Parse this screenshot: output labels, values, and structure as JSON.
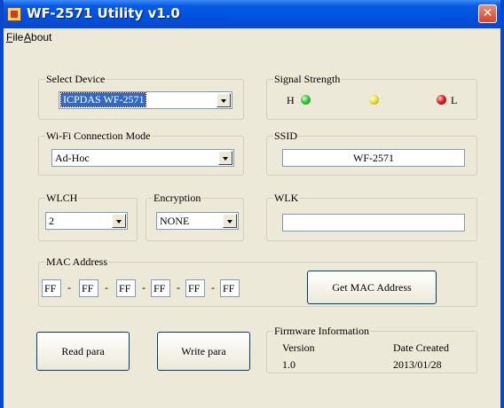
{
  "window": {
    "title": "WF-2571 Utility v1.0",
    "close_glyph": "✕"
  },
  "menu": [
    {
      "hotkey": "F",
      "rest": "ile"
    },
    {
      "hotkey": "A",
      "rest": "bout"
    }
  ],
  "select_device": {
    "label": "Select Device",
    "value": "ICPDAS WF-2571"
  },
  "signal_strength": {
    "label": "Signal Strength",
    "high_label": "H",
    "low_label": "L",
    "colors": {
      "high": "#3cc83c",
      "mid": "#f0e040",
      "low": "#e02020"
    }
  },
  "wifi_mode": {
    "label": "Wi-Fi Connection Mode",
    "value": "Ad-Hoc"
  },
  "ssid": {
    "label": "SSID",
    "value": "WF-2571"
  },
  "wlch": {
    "label": "WLCH",
    "value": "2"
  },
  "encryption": {
    "label": "Encryption",
    "value": "NONE"
  },
  "wlk": {
    "label": "WLK",
    "value": ""
  },
  "mac_address": {
    "label": "MAC Address",
    "octets": [
      "FF",
      "FF",
      "FF",
      "FF",
      "FF",
      "FF"
    ],
    "separator": "-",
    "button_label": "Get MAC Address"
  },
  "actions": {
    "read_label": "Read para",
    "write_label": "Write para"
  },
  "firmware": {
    "label": "Firmware Information",
    "version_header": "Version",
    "date_header": "Date Created",
    "version": "1.0",
    "date": "2013/01/28"
  }
}
